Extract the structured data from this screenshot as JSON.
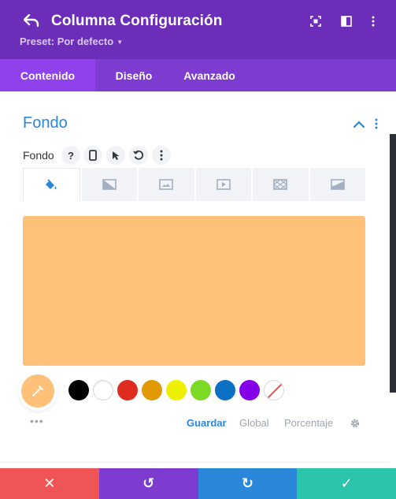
{
  "header": {
    "title": "Columna Configuración",
    "preset_label": "Preset: Por defecto",
    "bg_color": "#6c2eb9",
    "icons": [
      "back-icon",
      "focus-icon",
      "split-view-icon",
      "more-vertical-icon"
    ]
  },
  "tabs": [
    {
      "label": "Contenido",
      "active": true
    },
    {
      "label": "Diseño",
      "active": false
    },
    {
      "label": "Avanzado",
      "active": false
    }
  ],
  "section": {
    "title": "Fondo",
    "field_label": "Fondo",
    "help_glyph": "?",
    "field_icons": [
      "help-icon",
      "mobile-icon",
      "cursor-icon",
      "reset-icon",
      "more-vertical-icon"
    ]
  },
  "background_types": [
    {
      "icon": "paint-bucket-icon",
      "active": true
    },
    {
      "icon": "gradient-icon",
      "active": false
    },
    {
      "icon": "image-icon",
      "active": false
    },
    {
      "icon": "video-icon",
      "active": false
    },
    {
      "icon": "pattern-icon",
      "active": false
    },
    {
      "icon": "mask-icon",
      "active": false
    }
  ],
  "color": {
    "selected": "#ffc17a",
    "swatches": [
      "#000000",
      "#ffffff",
      "#e02b20",
      "#e09900",
      "#edf000",
      "#7cda24",
      "#0c71c3",
      "#8300e9"
    ]
  },
  "palette_actions": {
    "more": "•••",
    "save": "Guardar",
    "global": "Global",
    "percentage": "Porcentaje"
  },
  "bottom_bar": [
    {
      "icon": "close-icon",
      "glyph": "✕",
      "color": "#ef5555"
    },
    {
      "icon": "undo-icon",
      "glyph": "↺",
      "color": "#7e3bd0"
    },
    {
      "icon": "redo-icon",
      "glyph": "↻",
      "color": "#2b87da"
    },
    {
      "icon": "check-icon",
      "glyph": "✓",
      "color": "#29c4a9"
    }
  ]
}
